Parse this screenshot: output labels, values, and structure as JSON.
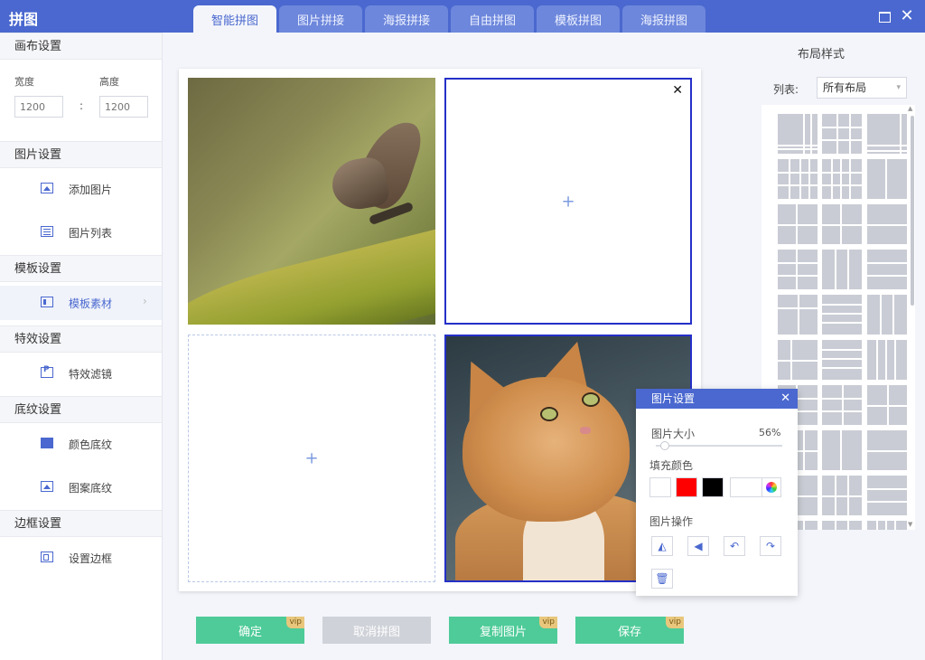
{
  "app": {
    "title": "拼图"
  },
  "tabs": [
    "智能拼图",
    "图片拼接",
    "海报拼接",
    "自由拼图",
    "模板拼图",
    "海报拼图"
  ],
  "window": {
    "close_glyph": "✕"
  },
  "sidebar": {
    "canvas_section": "画布设置",
    "width_label": "宽度",
    "height_label": "高度",
    "width_placeholder": "1200",
    "height_placeholder": "1200",
    "colon": ":",
    "image_section": "图片设置",
    "add_image": "添加图片",
    "image_list": "图片列表",
    "template_section": "模板设置",
    "template_material": "模板素材",
    "chevron": "›",
    "effects_section": "特效设置",
    "effects_filter": "特效滤镜",
    "texture_section": "底纹设置",
    "color_texture": "颜色底纹",
    "pattern_texture": "图案底纹",
    "border_section": "边框设置",
    "set_border": "设置边框"
  },
  "canvas": {
    "plus": "+",
    "close": "✕"
  },
  "actions": {
    "confirm": "确定",
    "cancel": "取消拼图",
    "copy": "复制图片",
    "save": "保存",
    "vip": "vip"
  },
  "right_panel": {
    "title": "布局样式",
    "list_label": "列表:",
    "list_value": "所有布局",
    "arrow": "▾",
    "scroll_up": "▲",
    "scroll_down": "▼"
  },
  "popup": {
    "title": "图片设置",
    "close": "✕",
    "size_label": "图片大小",
    "size_value": "56%",
    "size_fraction": 0.04,
    "fill_label": "填充颜色",
    "ops_label": "图片操作",
    "swatches": [
      "#ffffff",
      "#ff0000",
      "#000000",
      "#ffffff"
    ]
  }
}
